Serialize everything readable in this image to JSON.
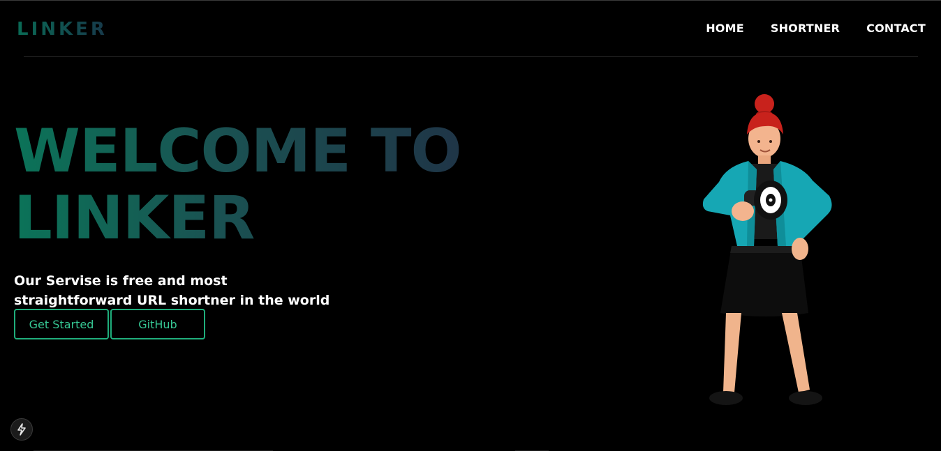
{
  "brand": {
    "logo": "LINKER"
  },
  "nav": {
    "items": [
      "HOME",
      "SHORTNER",
      "CONTACT"
    ]
  },
  "hero": {
    "title_line1": "WELCOME TO",
    "title_line2": "LINKER",
    "subtitle": "Our Servise is free and most straightforward URL shortner in the world",
    "buttons": {
      "get_started": "Get Started",
      "github": "GitHub"
    }
  },
  "colors": {
    "background": "#000000",
    "accent": "#1fae7c",
    "gradient_start": "#0b7358",
    "gradient_end": "#1f3547"
  },
  "icons": {
    "badge": "lightning-bolt-icon",
    "illustration": "woman-with-megaphone-illustration"
  }
}
